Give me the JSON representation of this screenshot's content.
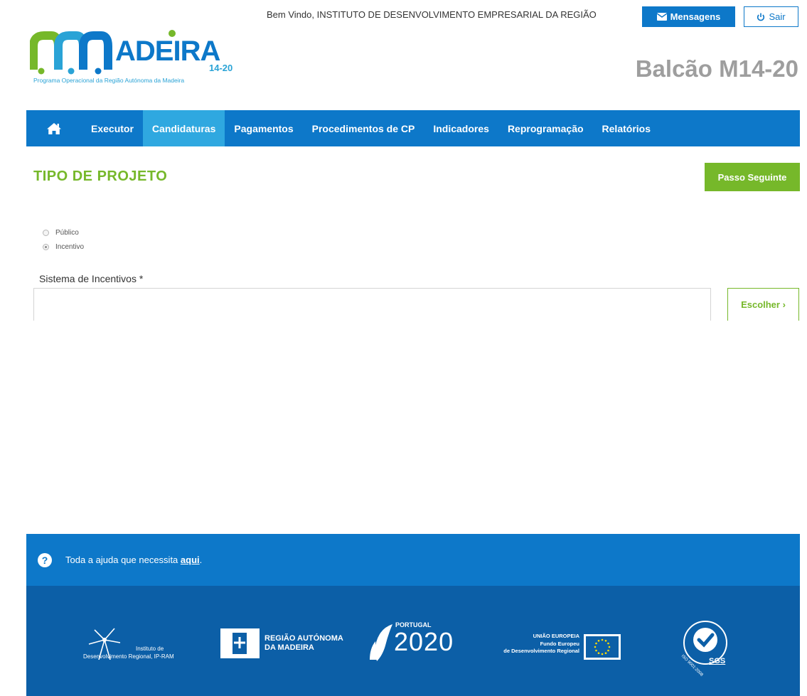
{
  "header": {
    "welcome_text": "Bem Vindo, INSTITUTO DE DESENVOLVIMENTO EMPRESARIAL DA REGIÃO",
    "messages_button": "Mensagens",
    "exit_button": "Sair",
    "logo_text": "ADEIRA",
    "logo_years": "14-20",
    "logo_tagline": "Programa Operacional da Região Autónoma da Madeira",
    "portal_title": "Balcão M14-20"
  },
  "nav": {
    "home_icon": "home-icon",
    "items": [
      {
        "label": "Executor",
        "active": false
      },
      {
        "label": "Candidaturas",
        "active": true
      },
      {
        "label": "Pagamentos",
        "active": false
      },
      {
        "label": "Procedimentos de CP",
        "active": false
      },
      {
        "label": "Indicadores",
        "active": false
      },
      {
        "label": "Reprogramação",
        "active": false
      },
      {
        "label": "Relatórios",
        "active": false
      }
    ]
  },
  "main": {
    "title": "TIPO DE PROJETO",
    "next_button": "Passo Seguinte",
    "project_type_options": [
      {
        "label": "Público",
        "checked": false
      },
      {
        "label": "Incentivo",
        "checked": true
      }
    ],
    "incentive_system": {
      "label": "Sistema de Incentivos *",
      "value": "",
      "choose_button": "Escolher ›"
    }
  },
  "help": {
    "text": "Toda a ajuda que necessita ",
    "link": "aqui",
    "suffix": "."
  },
  "footer": {
    "logos": {
      "idr_line1": "Instituto de",
      "idr_line2": "Desenvolvimento Regional, IP-RAM",
      "region_line1": "REGIÃO AUTÓNOMA",
      "region_line2": "DA MADEIRA",
      "portugal": "PORTUGAL",
      "year": "2020",
      "eu_line1": "UNIÃO EUROPEIA",
      "eu_line2": "Fundo Europeu",
      "eu_line3": "de Desenvolvimento Regional",
      "iso": "ISO 9001:2008",
      "sgs": "SGS"
    }
  },
  "colors": {
    "primary_blue": "#0d78c9",
    "active_tab": "#2fa8e0",
    "accent_green": "#76b82a",
    "footer_blue": "#0c5fa7"
  }
}
